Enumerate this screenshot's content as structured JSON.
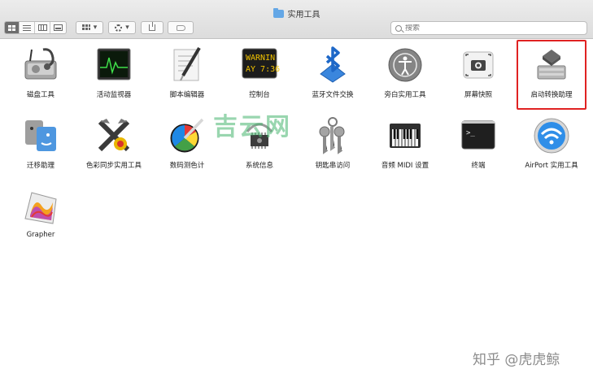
{
  "window": {
    "title": "实用工具"
  },
  "toolbar": {
    "search_placeholder": "搜索",
    "arrange_caret": "▾",
    "action_caret": "▾"
  },
  "apps": [
    {
      "label": "磁盘工具",
      "icon": "disk-utility-icon"
    },
    {
      "label": "活动监视器",
      "icon": "activity-monitor-icon"
    },
    {
      "label": "脚本编辑器",
      "icon": "script-editor-icon"
    },
    {
      "label": "控制台",
      "icon": "console-icon",
      "screen_line1": "WARNIN",
      "screen_line2": "AY 7:36"
    },
    {
      "label": "蓝牙文件交换",
      "icon": "bluetooth-icon"
    },
    {
      "label": "旁白实用工具",
      "icon": "voiceover-icon"
    },
    {
      "label": "屏幕快照",
      "icon": "screenshot-icon"
    },
    {
      "label": "启动转换助理",
      "icon": "boot-camp-icon",
      "selected": true
    },
    {
      "label": "迁移助理",
      "icon": "migration-assistant-icon"
    },
    {
      "label": "色彩同步实用工具",
      "icon": "colorsync-icon"
    },
    {
      "label": "数码测色计",
      "icon": "digital-color-meter-icon"
    },
    {
      "label": "系统信息",
      "icon": "system-information-icon"
    },
    {
      "label": "钥匙串访问",
      "icon": "keychain-icon"
    },
    {
      "label": "音频 MIDI 设置",
      "icon": "audio-midi-icon"
    },
    {
      "label": "终端",
      "icon": "terminal-icon",
      "screen_line1": ">_"
    },
    {
      "label": "AirPort 实用工具",
      "icon": "airport-icon"
    },
    {
      "label": "Grapher",
      "icon": "grapher-icon"
    }
  ],
  "overlay": {
    "watermark": "吉云网",
    "signature": "知乎 @虎虎鲸"
  },
  "colors": {
    "selection": "#e02222",
    "watermark": "#46b46e"
  }
}
